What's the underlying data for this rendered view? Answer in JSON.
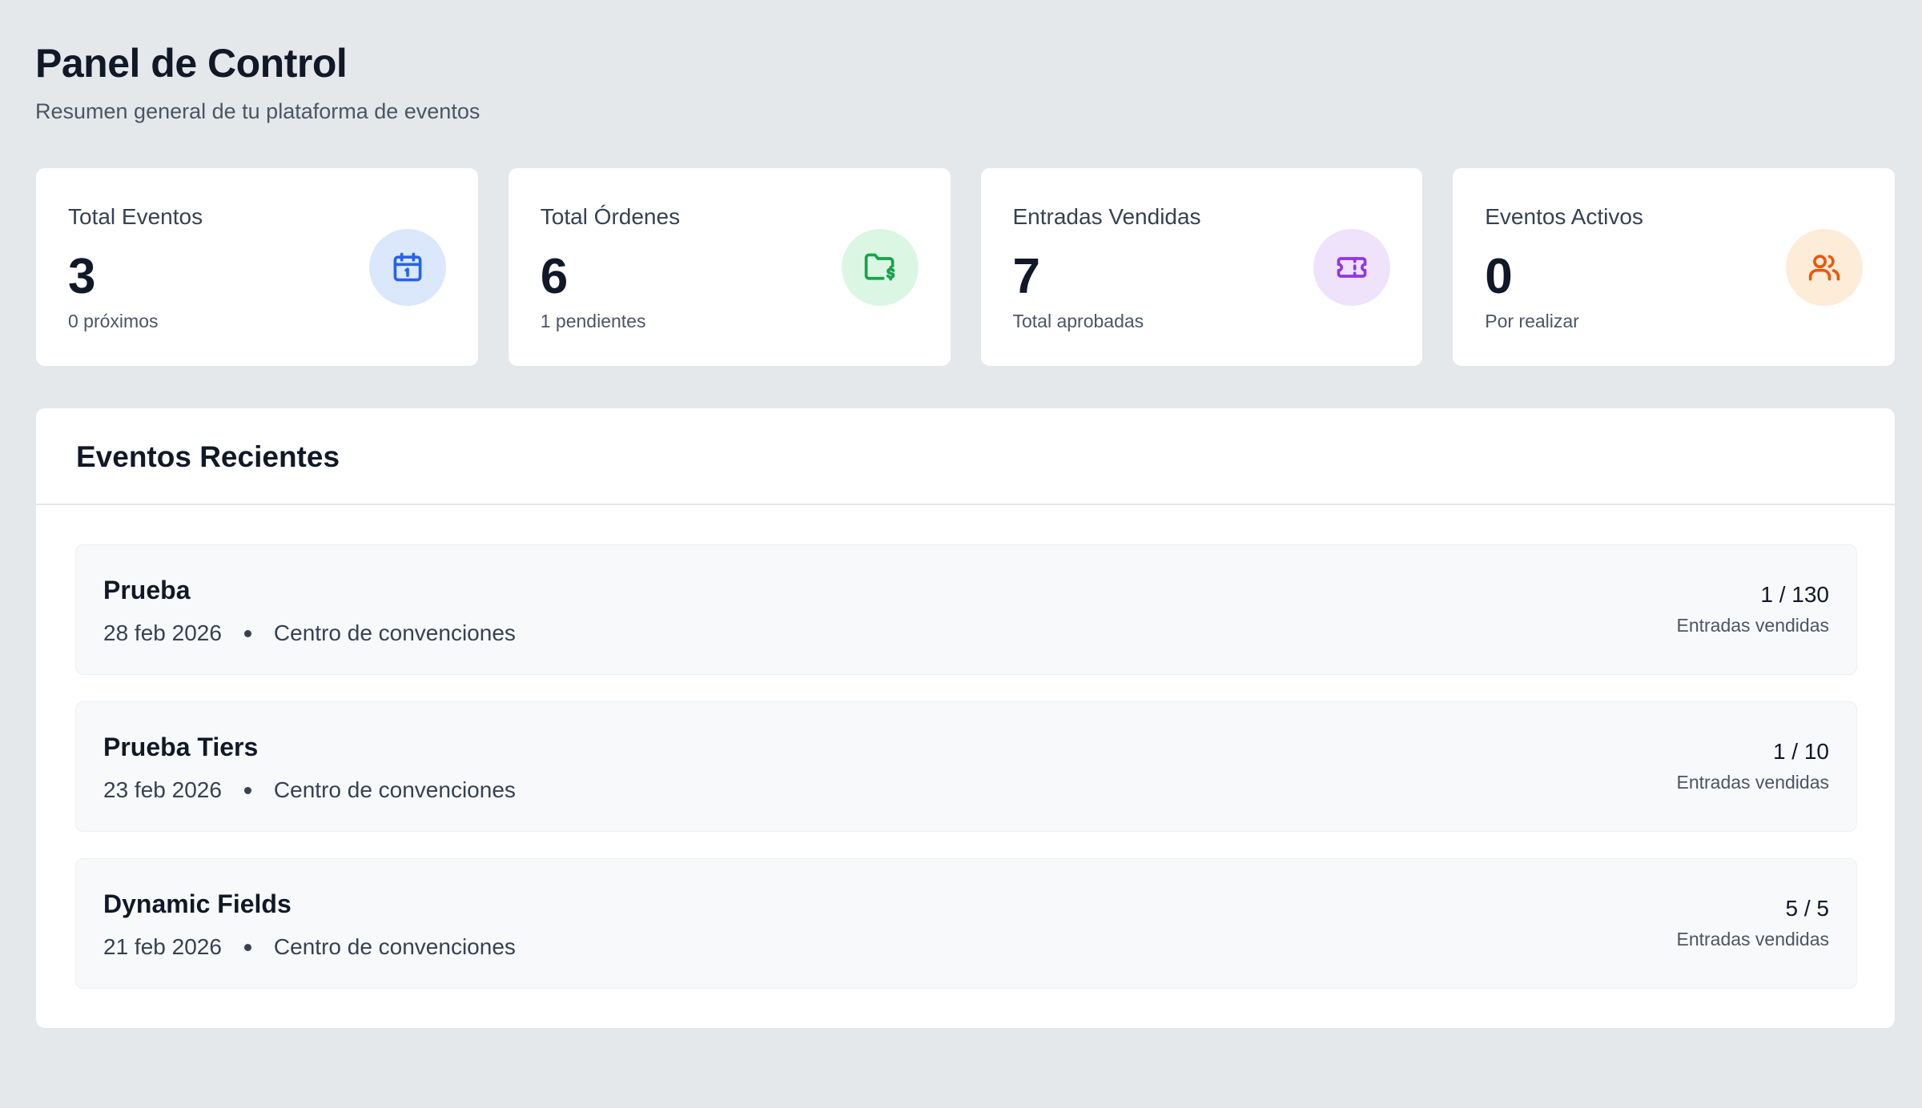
{
  "header": {
    "title": "Panel de Control",
    "subtitle": "Resumen general de tu plataforma de eventos"
  },
  "stats": [
    {
      "label": "Total Eventos",
      "value": "3",
      "note": "0 próximos",
      "icon": "calendar-icon",
      "icon_color": "#2563eb",
      "icon_bg": "#dbe7fb"
    },
    {
      "label": "Total Órdenes",
      "value": "6",
      "note": "1 pendientes",
      "icon": "folder-dollar-icon",
      "icon_color": "#16a34a",
      "icon_bg": "#dcf6e4"
    },
    {
      "label": "Entradas Vendidas",
      "value": "7",
      "note": "Total aprobadas",
      "icon": "ticket-icon",
      "icon_color": "#9333ea",
      "icon_bg": "#efe3fb"
    },
    {
      "label": "Eventos Activos",
      "value": "0",
      "note": "Por realizar",
      "icon": "users-icon",
      "icon_color": "#ea580c",
      "icon_bg": "#fdecd8"
    }
  ],
  "recent": {
    "title": "Eventos Recientes",
    "events": [
      {
        "name": "Prueba",
        "date": "28 feb 2026",
        "location": "Centro de convenciones",
        "sold": "1 / 130",
        "sold_label": "Entradas vendidas"
      },
      {
        "name": "Prueba Tiers",
        "date": "23 feb 2026",
        "location": "Centro de convenciones",
        "sold": "1 / 10",
        "sold_label": "Entradas vendidas"
      },
      {
        "name": "Dynamic Fields",
        "date": "21 feb 2026",
        "location": "Centro de convenciones",
        "sold": "5 / 5",
        "sold_label": "Entradas vendidas"
      }
    ]
  }
}
